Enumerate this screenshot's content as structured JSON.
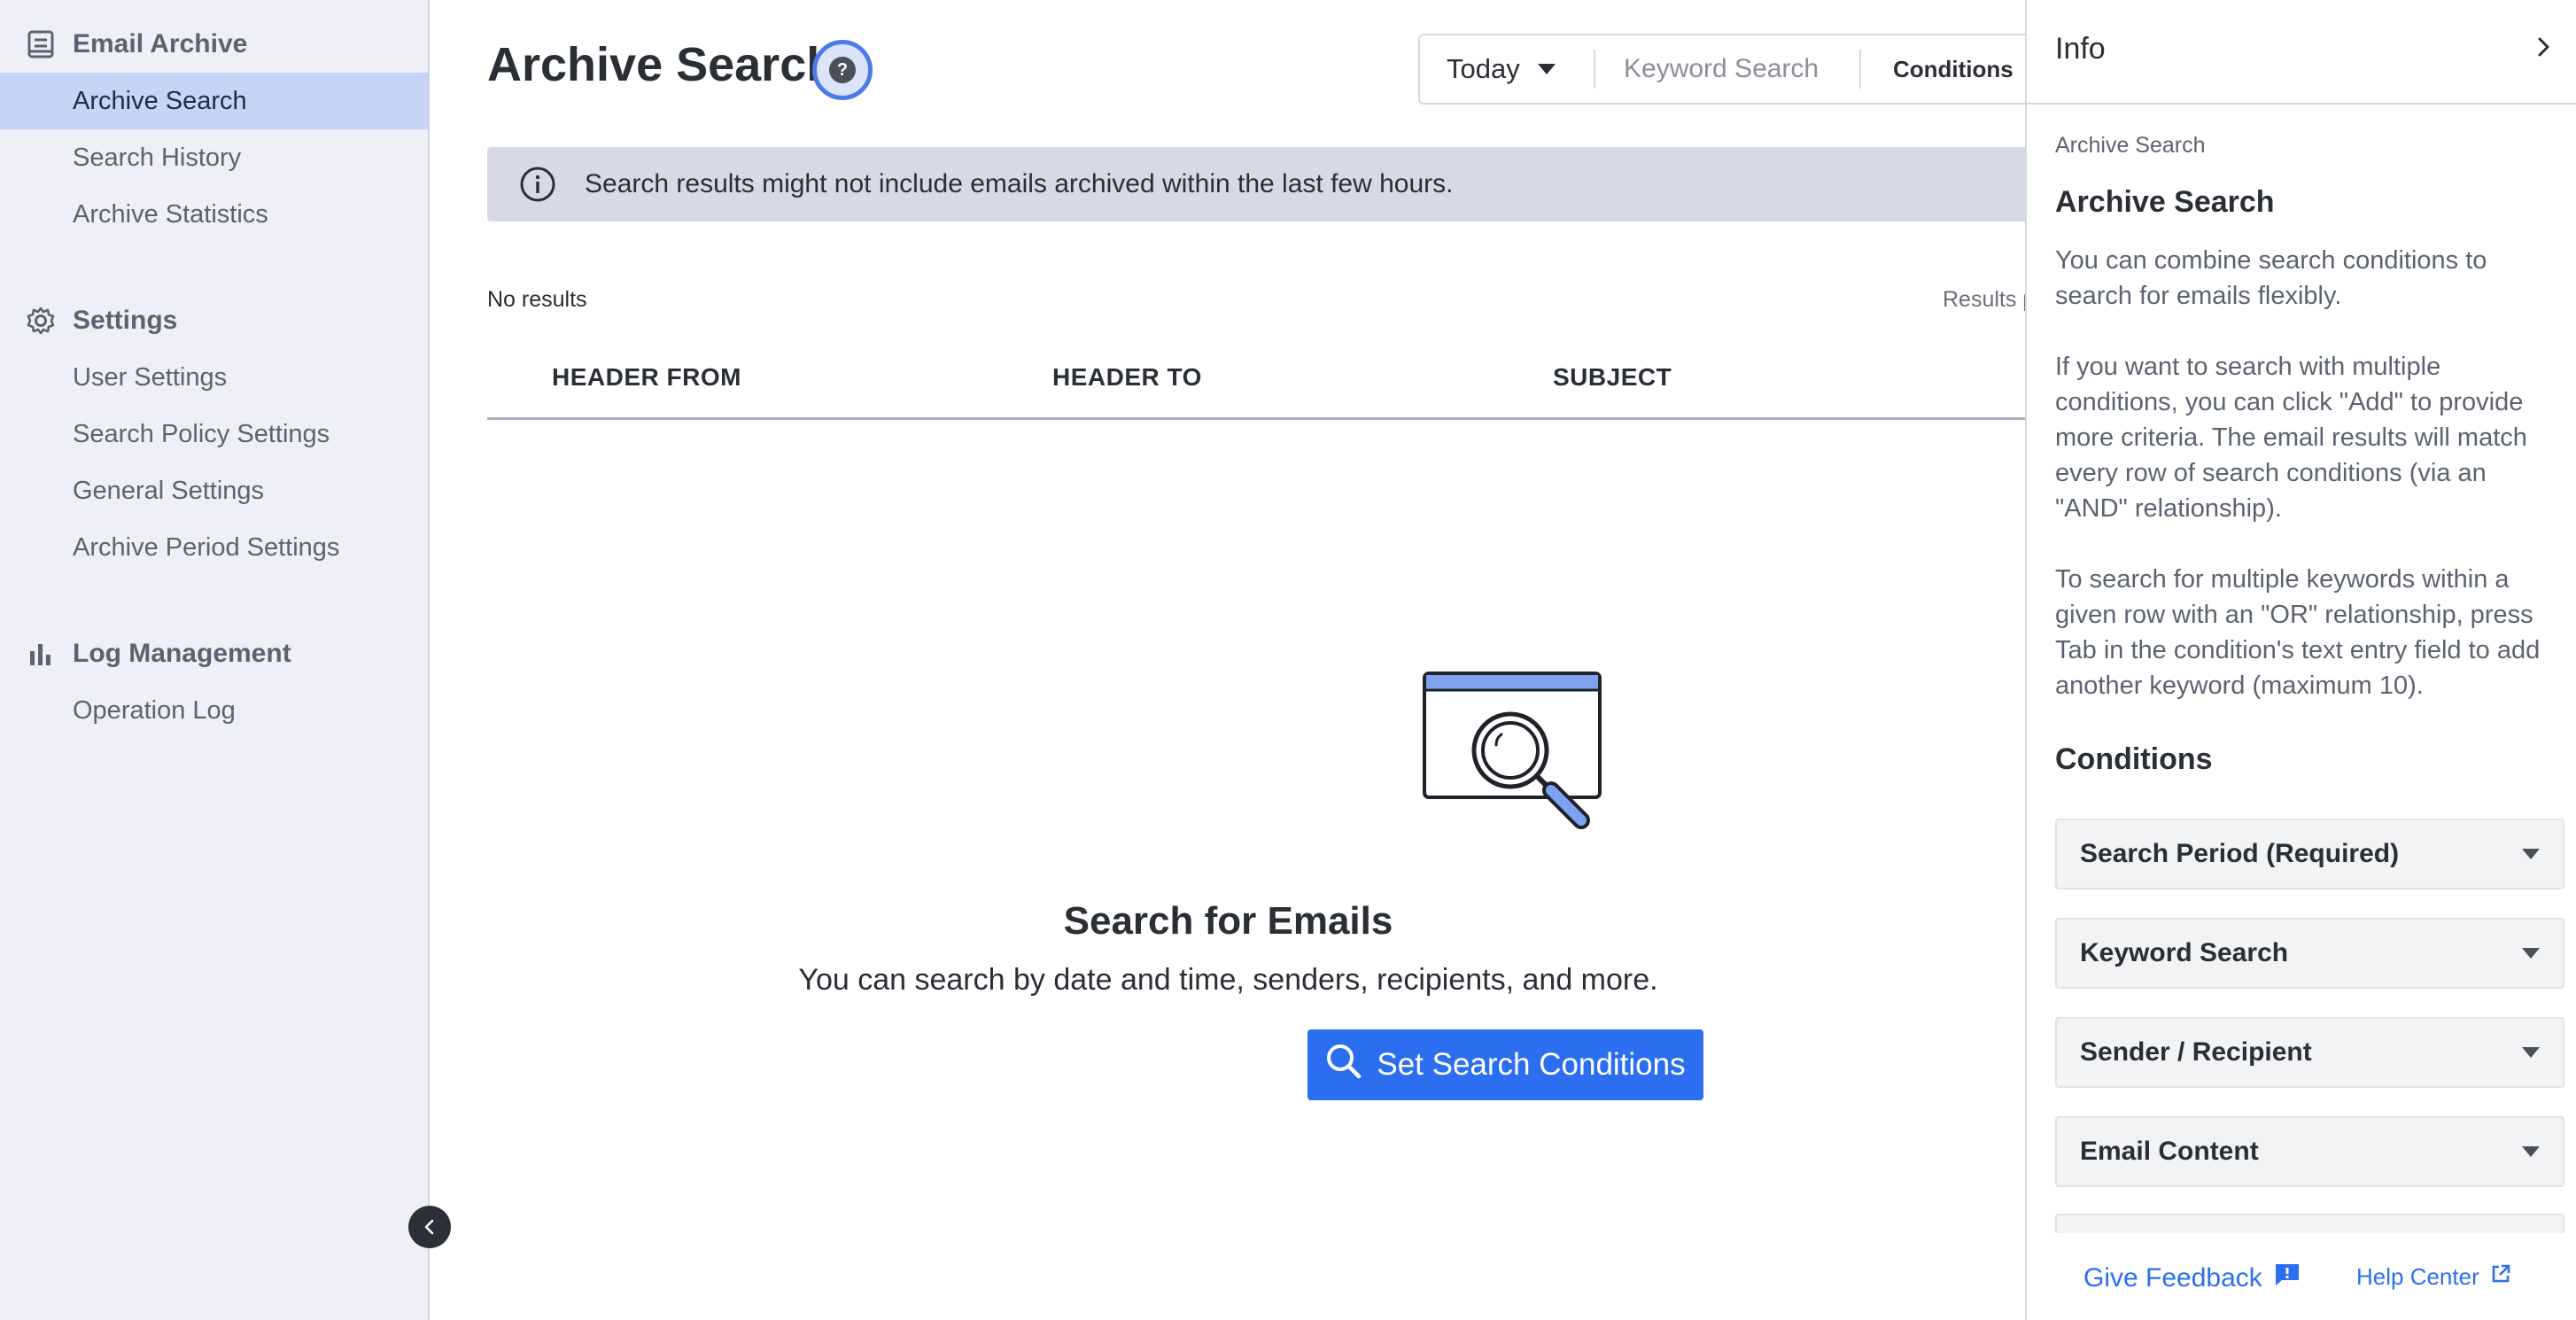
{
  "sidebar": {
    "sections": [
      {
        "title": "Email Archive",
        "icon": "document-list-icon",
        "items": [
          {
            "label": "Archive Search",
            "active": true
          },
          {
            "label": "Search History",
            "active": false
          },
          {
            "label": "Archive Statistics",
            "active": false
          }
        ]
      },
      {
        "title": "Settings",
        "icon": "gear-icon",
        "items": [
          {
            "label": "User Settings",
            "active": false
          },
          {
            "label": "Search Policy Settings",
            "active": false
          },
          {
            "label": "General Settings",
            "active": false
          },
          {
            "label": "Archive Period Settings",
            "active": false
          }
        ]
      },
      {
        "title": "Log Management",
        "icon": "bar-chart-icon",
        "items": [
          {
            "label": "Operation Log",
            "active": false
          }
        ]
      }
    ]
  },
  "main": {
    "title": "Archive Search",
    "toolbar": {
      "period": "Today",
      "keyword_placeholder": "Keyword Search",
      "conditions_label": "Conditions"
    },
    "banner": "Search results might not include emails archived within the last few hours.",
    "results_count": "No results",
    "results_per_page_label": "Results p",
    "columns": [
      "HEADER FROM",
      "HEADER TO",
      "SUBJECT"
    ],
    "empty": {
      "title": "Search for Emails",
      "description": "You can search by date and time, senders, recipients, and more.",
      "cta": "Set Search Conditions"
    }
  },
  "info_panel": {
    "title": "Info",
    "breadcrumb": "Archive Search",
    "heading": "Archive Search",
    "paragraphs": [
      "You can combine search conditions to search for emails flexibly.",
      "If you want to search with multiple conditions, you can click \"Add\" to provide more criteria. The email results will match every row of search conditions (via an \"AND\" relationship).",
      "To search for multiple keywords within a given row with an \"OR\" relationship, press Tab in the condition's text entry field to add another keyword (maximum 10)."
    ],
    "conditions_heading": "Conditions",
    "conditions": [
      "Search Period (Required)",
      "Keyword Search",
      "Sender / Recipient",
      "Email Content"
    ],
    "feedback_label": "Give Feedback",
    "help_center_label": "Help Center"
  },
  "colors": {
    "accent": "#2b6ff0",
    "sidebar_bg": "#eef0f5",
    "sidebar_active": "#c6d5f5",
    "banner_bg": "#d7dae2"
  }
}
